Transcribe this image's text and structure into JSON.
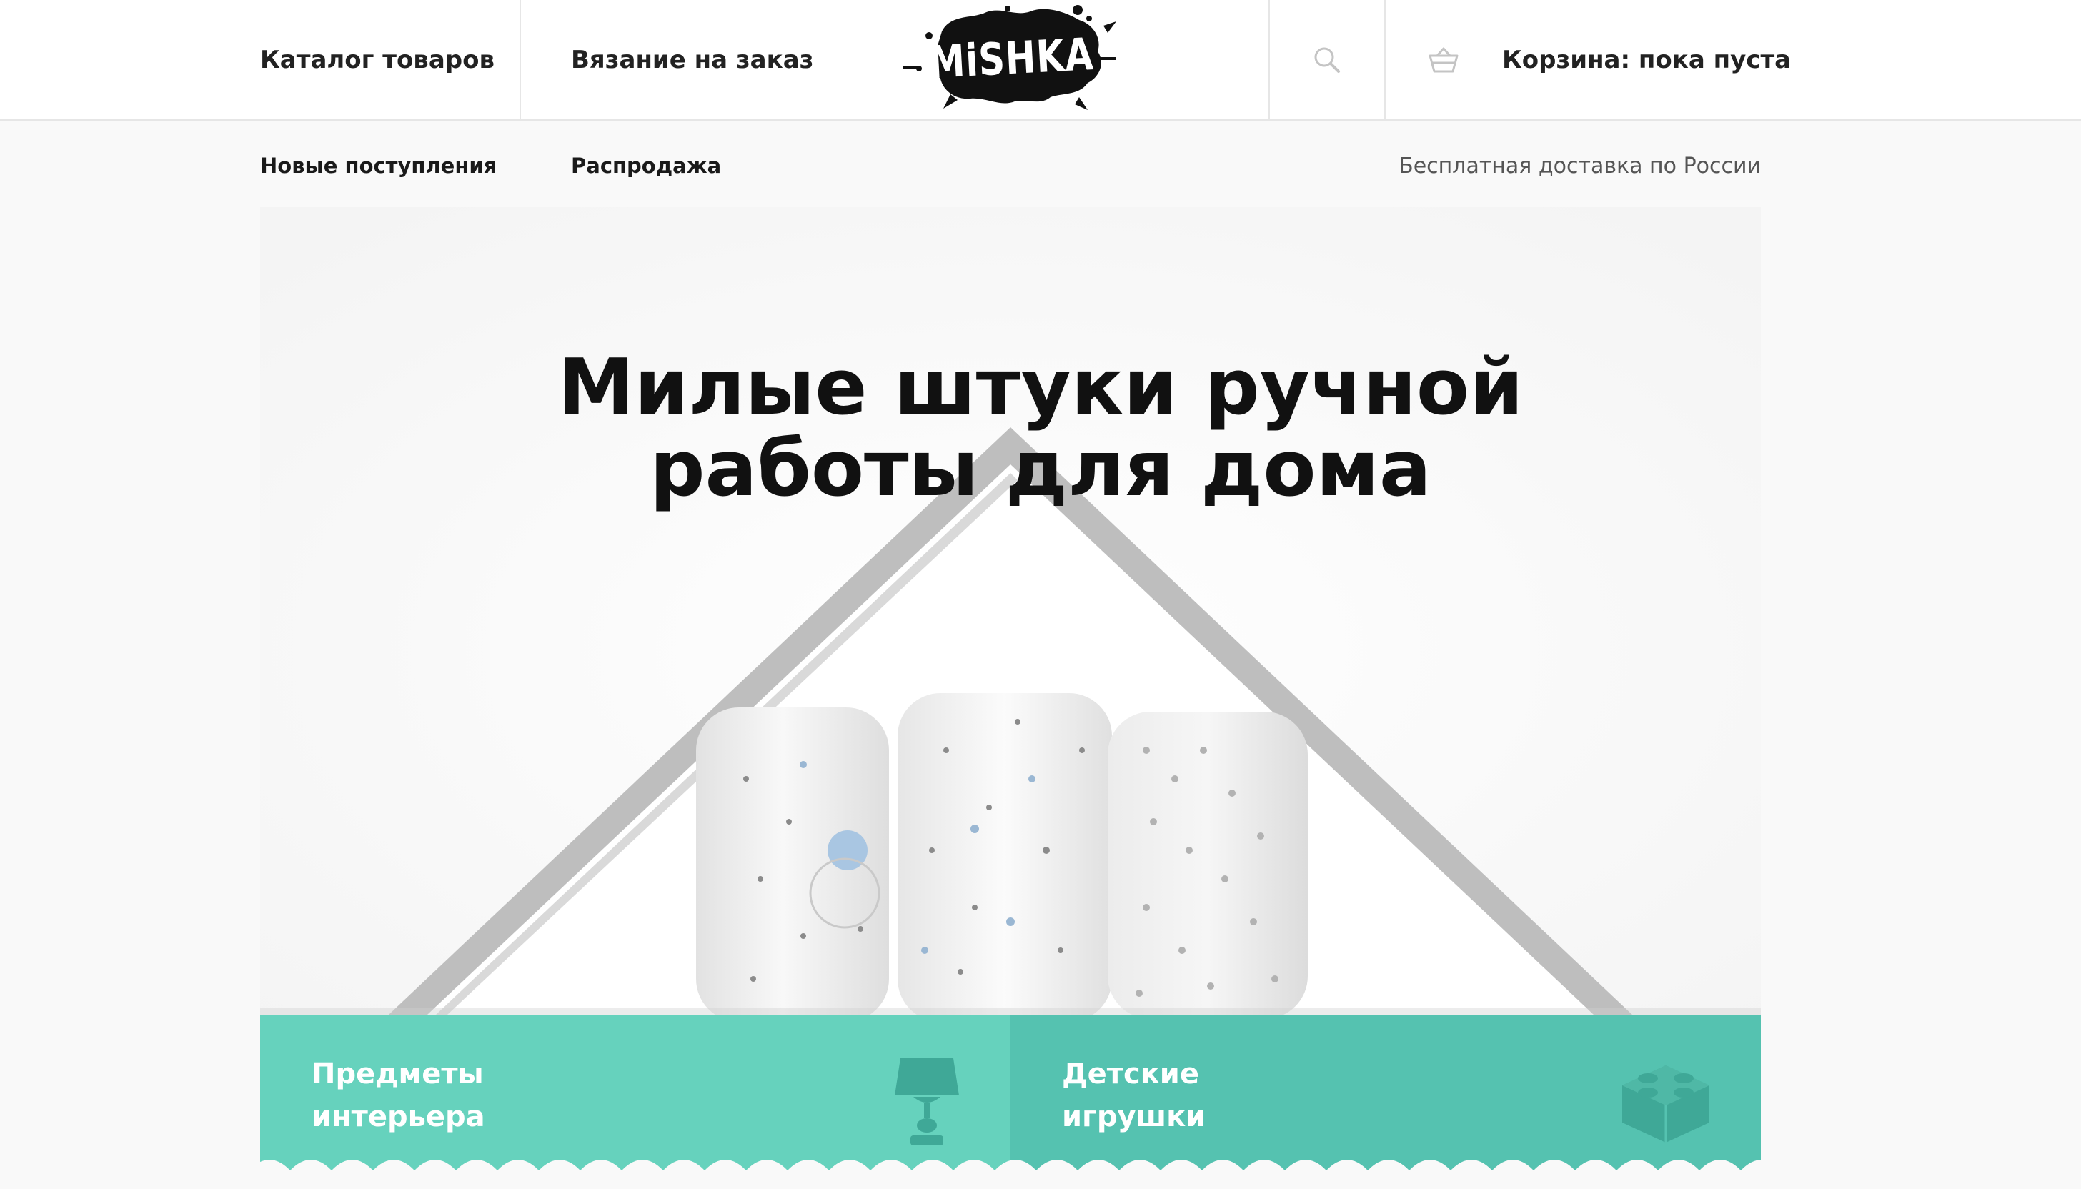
{
  "header": {
    "nav_catalog": "Каталог товаров",
    "nav_knitting": "Вязание на заказ",
    "logo_text": "MiSHKA",
    "search_icon": "search-icon",
    "cart_icon": "basket-icon",
    "cart_label": "Корзина: пока пуста"
  },
  "subnav": {
    "new_arrivals": "Новые поступления",
    "sale": "Распродажа",
    "delivery_note": "Бесплатная доставка по России"
  },
  "hero": {
    "title_line1": "Милые штуки ручной",
    "title_line2": "работы для дома"
  },
  "categories": [
    {
      "line1": "Предметы",
      "line2": "интерьера",
      "icon": "lamp-icon",
      "color": "#66d2bd"
    },
    {
      "line1": "Детские",
      "line2": "игрушки",
      "icon": "toy-block-icon",
      "color": "#55c2b0"
    }
  ],
  "colors": {
    "accent_teal": "#66d2bd",
    "accent_teal_dark": "#55c2b0",
    "icon_teal": "#3fa897",
    "text_dark": "#222222"
  }
}
